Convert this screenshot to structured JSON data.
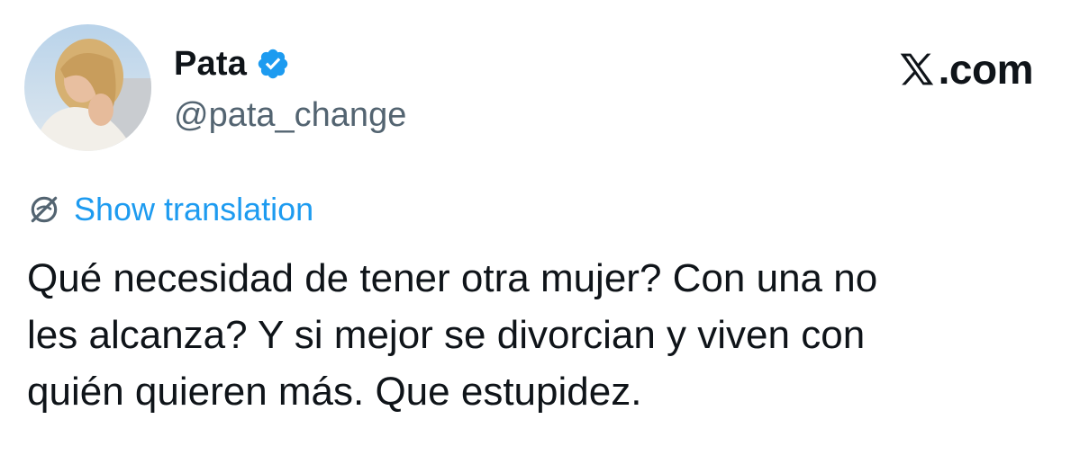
{
  "author": {
    "display_name": "Pata",
    "handle": "@pata_change",
    "verified": true,
    "avatar_icon": "user-photo"
  },
  "site": {
    "label": ".com",
    "logo_icon": "x-logo-icon"
  },
  "translation": {
    "label": "Show translation",
    "icon": "globe-strike-icon"
  },
  "tweet": {
    "text": "Qué necesidad de tener otra mujer? Con una no\nles alcanza? Y si mejor se divorcian y viven con\nquién quieren más. Que estupidez."
  },
  "colors": {
    "link": "#1d9bf0",
    "verified": "#1d9bf0",
    "muted": "#536471",
    "text": "#0f1419"
  }
}
